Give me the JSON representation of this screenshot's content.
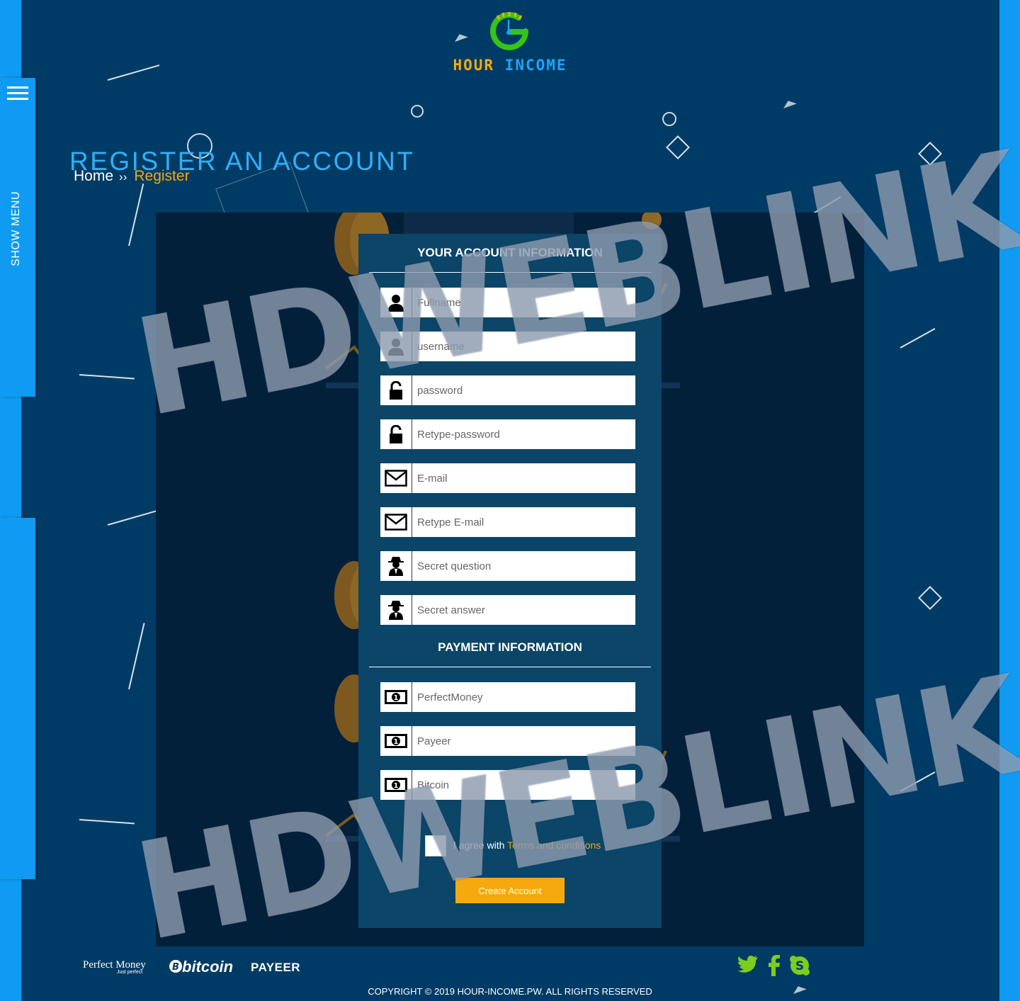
{
  "side_menu": {
    "label": "SHOW MENU"
  },
  "brand": {
    "word1": "HOUR",
    "word2": "INCOME"
  },
  "page": {
    "title": "REGISTER AN ACCOUNT"
  },
  "breadcrumb": {
    "home": "Home",
    "separator": "››",
    "current": "Register"
  },
  "account_section": {
    "title": "YOUR ACCOUNT INFORMATION",
    "fields": [
      {
        "placeholder": "Fullname",
        "icon": "user-icon"
      },
      {
        "placeholder": "username",
        "icon": "user-icon"
      },
      {
        "placeholder": "password",
        "icon": "lock-icon"
      },
      {
        "placeholder": "Retype-password",
        "icon": "lock-icon"
      },
      {
        "placeholder": "E-mail",
        "icon": "envelope-icon"
      },
      {
        "placeholder": "Retype E-mail",
        "icon": "envelope-icon"
      },
      {
        "placeholder": "Secret question",
        "icon": "spy-icon"
      },
      {
        "placeholder": "Secret answer",
        "icon": "spy-icon"
      }
    ]
  },
  "payment_section": {
    "title": "PAYMENT INFORMATION",
    "fields": [
      {
        "placeholder": "PerfectMoney",
        "icon": "banknote-icon"
      },
      {
        "placeholder": "Payeer",
        "icon": "banknote-icon"
      },
      {
        "placeholder": "Bitcoin",
        "icon": "banknote-icon"
      }
    ]
  },
  "agreement": {
    "prefix": "I agree with",
    "link": "Terms and conditions"
  },
  "submit": {
    "label": "Create Account"
  },
  "footer": {
    "payments": {
      "perfect_money": "Perfect Money",
      "perfect_money_tag": "Just perfect",
      "bitcoin": "bitcoin",
      "payeer": "PAYEER"
    },
    "social": [
      "twitter-icon",
      "facebook-icon",
      "skype-icon"
    ],
    "copyright": "COPYRIGHT © 2019 HOUR-INCOME.PW. ALL RIGHTS RESERVED"
  },
  "watermark": {
    "text": "HDWEBLINK.COM"
  },
  "colors": {
    "accent_orange": "#f5a90f",
    "accent_blue": "#0f9bf2",
    "page_bg": "#003b66",
    "panel_bg": "#02203a",
    "card_bg": "#0b4568"
  }
}
